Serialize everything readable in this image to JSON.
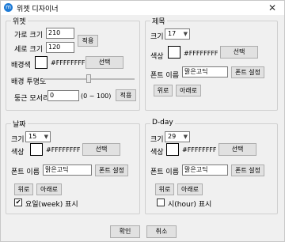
{
  "window": {
    "title": "위젯 디자이너",
    "close": "✕"
  },
  "widget": {
    "title": "위젯",
    "width_label": "가로 크기",
    "width_value": "210",
    "height_label": "세로 크기",
    "height_value": "120",
    "apply_size": "적용",
    "bgcolor_label": "배경색",
    "bgcolor_value": "#FFFFFFFF",
    "bgcolor_select": "선택",
    "opacity_label": "배경 투명도",
    "opacity_level": 0.5,
    "radius_label": "둥근 모서리",
    "radius_value": "0",
    "radius_range": "(0 ~ 100)",
    "apply_radius": "적용"
  },
  "title_group": {
    "title": "제목",
    "size_label": "크기",
    "size_value": "17",
    "color_label": "색상",
    "color_value": "#FFFFFFFF",
    "color_select": "선택",
    "font_label": "폰트 이름",
    "font_value": "맑은고딕",
    "font_setting": "폰트 설정",
    "up": "위로",
    "down": "아래로"
  },
  "date_group": {
    "title": "날짜",
    "size_label": "크기",
    "size_value": "15",
    "color_label": "색상",
    "color_value": "#FFFFFFFF",
    "color_select": "선택",
    "font_label": "폰트 이름",
    "font_value": "맑은고딕",
    "font_setting": "폰트 설정",
    "up": "위로",
    "down": "아래로",
    "checkbox_label": "요일(week) 표시",
    "checked": "✔"
  },
  "dday_group": {
    "title": "D-day",
    "size_label": "크기",
    "size_value": "29",
    "color_label": "색상",
    "color_value": "#FFFFFFFF",
    "color_select": "선택",
    "font_label": "폰트 이름",
    "font_value": "맑은고딕",
    "font_setting": "폰트 설정",
    "up": "위로",
    "down": "아래로",
    "checkbox_label": "시(hour) 표시",
    "checked": ""
  },
  "footer": {
    "ok": "확인",
    "cancel": "취소"
  },
  "colors": {
    "accent": "#1e7bd6"
  }
}
